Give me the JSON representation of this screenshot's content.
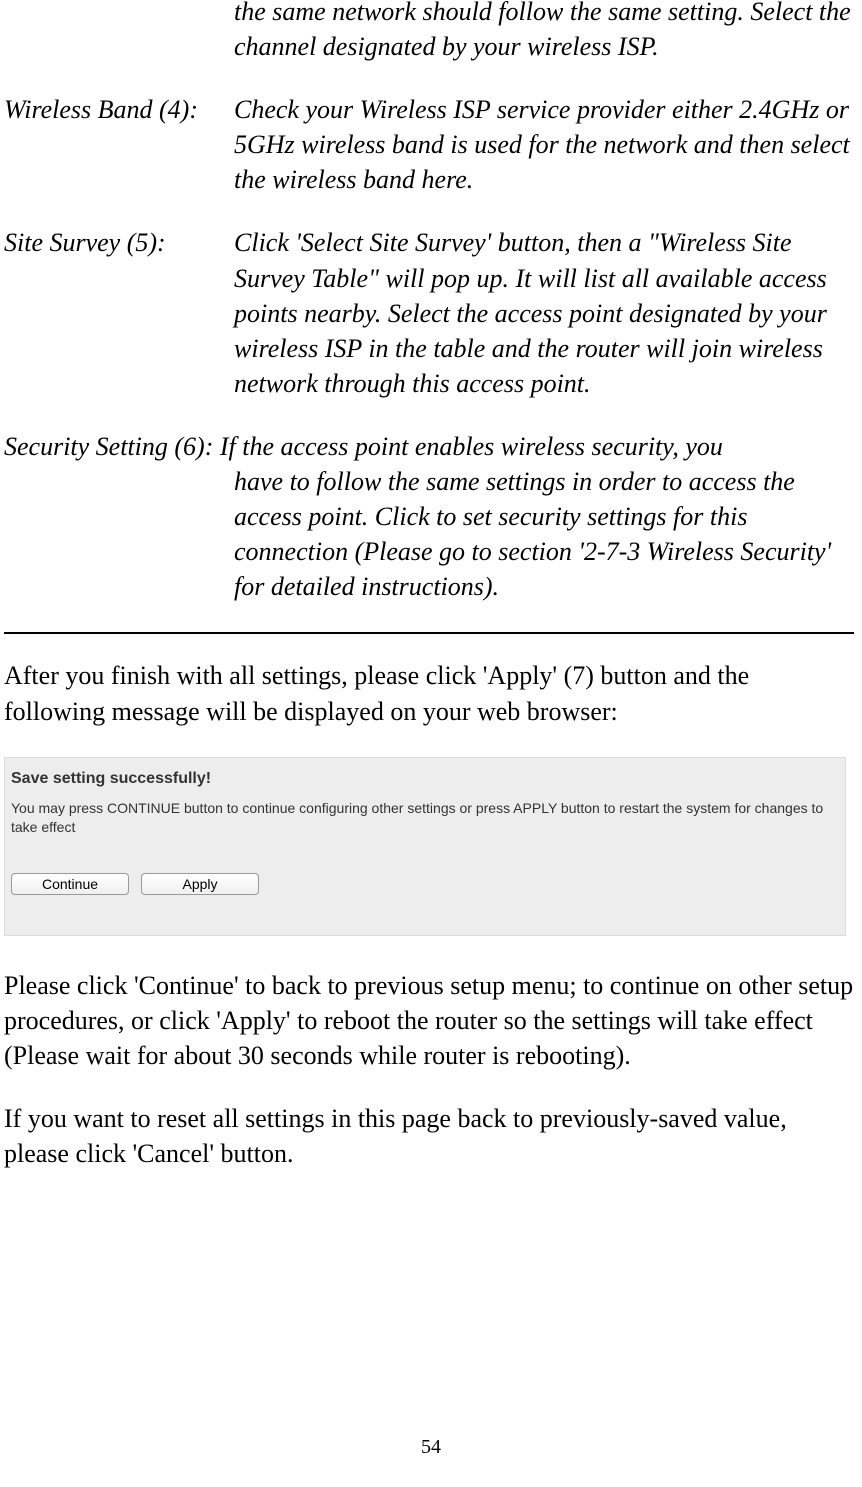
{
  "orphan_desc": "the same network should follow the same setting. Select the channel designated by your wireless ISP.",
  "item4": {
    "label": "Wireless Band (4):",
    "desc": "Check your Wireless ISP service provider either 2.4GHz or 5GHz wireless band is used for the network and then select the wireless band here."
  },
  "item5": {
    "label": "Site Survey (5):",
    "desc": "Click 'Select Site Survey' button, then a \"Wireless Site Survey Table\" will pop up. It will list all available access points nearby. Select the access point designated by your wireless ISP in the table and the router will join wireless network through this access point."
  },
  "item6": {
    "firstline": "Security Setting (6): If the access point enables wireless security, you",
    "restpara": "have to follow the same settings in order to access the access point. Click to set security settings for this connection   (Please go to section '2-7-3 Wireless Security' for detailed instructions)."
  },
  "para_after_hr": "After you finish with all settings, please click 'Apply' (7) button and the following message will be displayed on your web browser:",
  "screenshot": {
    "title": "Save setting successfully!",
    "desc": "You may press CONTINUE button to continue configuring other settings or press APPLY button to restart the system for changes to take effect",
    "btn_continue": "Continue",
    "btn_apply": "Apply"
  },
  "para2": "Please click 'Continue' to back to previous setup menu; to continue on other setup procedures, or click 'Apply' to reboot the router so the settings will take effect (Please wait for about 30 seconds while router is rebooting).",
  "para3": "If you want to reset all settings in this page back to previously-saved value, please click 'Cancel' button.",
  "page_number": "54"
}
